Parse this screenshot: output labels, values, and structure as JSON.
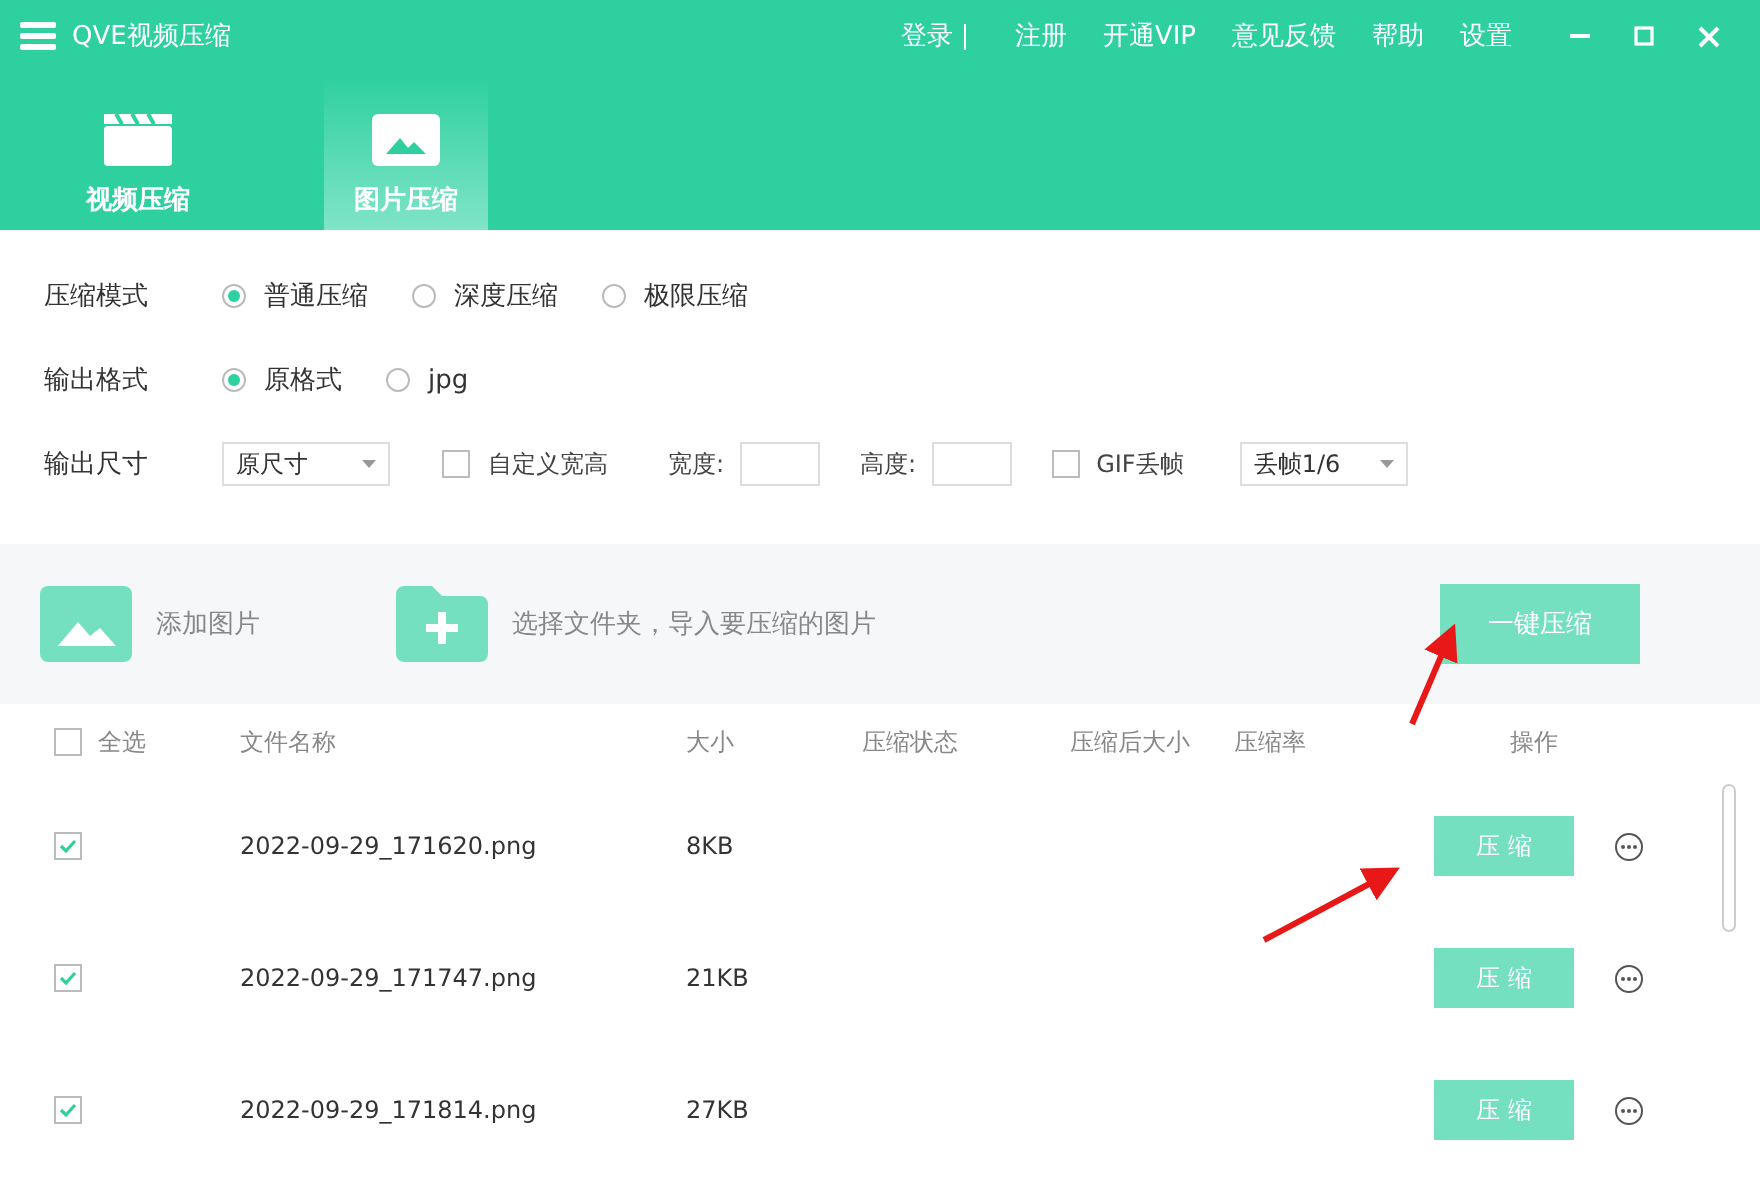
{
  "window": {
    "title": "QVE视频压缩"
  },
  "top_menu": [
    "登录",
    "注册",
    "开通VIP",
    "意见反馈",
    "帮助",
    "设置"
  ],
  "tabs": [
    {
      "label": "视频压缩",
      "kind": "video",
      "selected": false
    },
    {
      "label": "图片压缩",
      "kind": "image",
      "selected": true
    }
  ],
  "settings": {
    "compress_mode": {
      "label": "压缩模式",
      "options": [
        {
          "label": "普通压缩",
          "selected": true
        },
        {
          "label": "深度压缩",
          "selected": false
        },
        {
          "label": "极限压缩",
          "selected": false
        }
      ]
    },
    "output_format": {
      "label": "输出格式",
      "options": [
        {
          "label": "原格式",
          "selected": true
        },
        {
          "label": "jpg",
          "selected": false
        }
      ]
    },
    "output_size": {
      "label": "输出尺寸",
      "size_select": "原尺寸",
      "custom": {
        "label": "自定义宽高",
        "checked": false
      },
      "width_label": "宽度:",
      "height_label": "高度:",
      "gif": {
        "label": "GIF丢帧",
        "checked": false
      },
      "frame_select": "丢帧1/6"
    }
  },
  "toolbar": {
    "add_image": "添加图片",
    "add_folder": "选择文件夹，导入要压缩的图片",
    "compress_all": "一键压缩"
  },
  "table": {
    "select_all": {
      "label": "全选",
      "checked": false
    },
    "columns": [
      "文件名称",
      "大小",
      "压缩状态",
      "压缩后大小",
      "压缩率",
      "操作"
    ],
    "rows": [
      {
        "checked": true,
        "name": "2022-09-29_171620.png",
        "size": "8KB",
        "action": "压 缩"
      },
      {
        "checked": true,
        "name": "2022-09-29_171747.png",
        "size": "21KB",
        "action": "压 缩"
      },
      {
        "checked": true,
        "name": "2022-09-29_171814.png",
        "size": "27KB",
        "action": "压 缩"
      }
    ]
  }
}
